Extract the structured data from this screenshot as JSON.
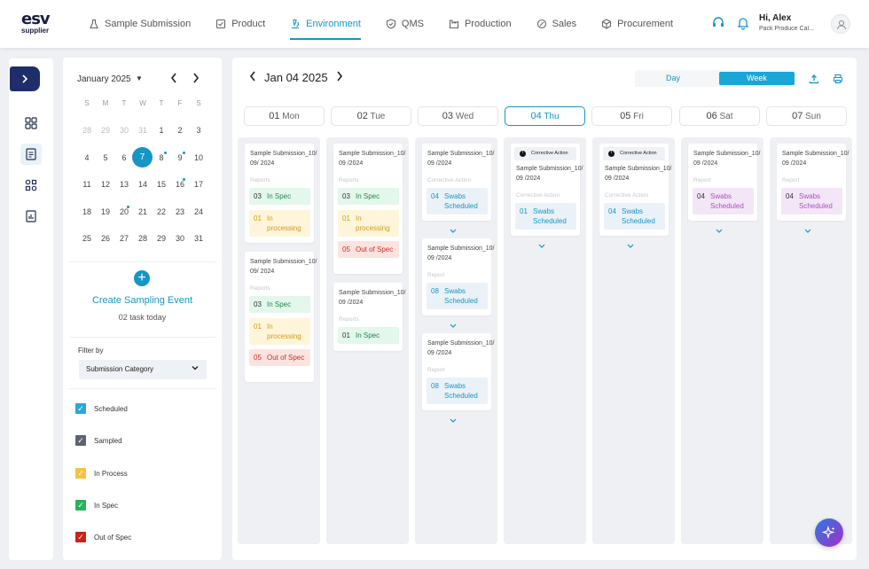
{
  "brand": {
    "logo_main": "esv",
    "logo_sub": "supplier"
  },
  "nav": {
    "items": [
      {
        "label": "Sample Submission",
        "icon": "flask-icon"
      },
      {
        "label": "Product",
        "icon": "box-check-icon"
      },
      {
        "label": "Environment",
        "icon": "microscope-icon",
        "active": true
      },
      {
        "label": "QMS",
        "icon": "shield-check-icon"
      },
      {
        "label": "Production",
        "icon": "factory-icon"
      },
      {
        "label": "Sales",
        "icon": "tag-icon"
      },
      {
        "label": "Procurement",
        "icon": "cube-icon"
      }
    ]
  },
  "user": {
    "greeting": "Hi, Alex",
    "org": "Pack Produce Cal..."
  },
  "calendar": {
    "month": "January 2025",
    "weekdays": [
      "S",
      "M",
      "T",
      "W",
      "T",
      "F",
      "S"
    ],
    "weeks": [
      [
        "28",
        "29",
        "30",
        "31",
        "1",
        "2",
        "3"
      ],
      [
        "4",
        "5",
        "6",
        "7",
        "8",
        "9",
        "10"
      ],
      [
        "11",
        "12",
        "13",
        "14",
        "15",
        "16",
        "17"
      ],
      [
        "18",
        "19",
        "20",
        "21",
        "22",
        "23",
        "24"
      ],
      [
        "25",
        "26",
        "27",
        "28",
        "29",
        "30",
        "31"
      ]
    ],
    "selected": "7"
  },
  "sampling": {
    "create_label": "Create Sampling Event",
    "task_count": "02 task today"
  },
  "filter": {
    "label": "Filter by",
    "selected": "Submission Category",
    "options": [
      {
        "label": "Scheduled",
        "color": "#2aa8d8"
      },
      {
        "label": "Sampled",
        "color": "#5d6470"
      },
      {
        "label": "In Process",
        "color": "#f5c342"
      },
      {
        "label": "In Spec",
        "color": "#27b35a"
      },
      {
        "label": "Out of Spec",
        "color": "#c8231c"
      }
    ]
  },
  "schedule": {
    "date": "Jan 04 2025",
    "view_day": "Day",
    "view_week": "Week",
    "days": [
      {
        "num": "01",
        "name": "Mon"
      },
      {
        "num": "02",
        "name": "Tue"
      },
      {
        "num": "03",
        "name": "Wed"
      },
      {
        "num": "04",
        "name": "Thu",
        "active": true
      },
      {
        "num": "05",
        "name": "Fri"
      },
      {
        "num": "06",
        "name": "Sat"
      },
      {
        "num": "07",
        "name": "Sun"
      }
    ],
    "columns": [
      [
        {
          "title": "Sample Submission_10/09/ 2024",
          "sub": "Reports",
          "badges": [
            {
              "n": "03",
              "t": "In Spec",
              "k": "green"
            },
            {
              "n": "01",
              "t": "In processing",
              "k": "yellow"
            }
          ]
        },
        {
          "title": "Sample Submission_10/09/ 2024",
          "sub": "Reports",
          "badges": [
            {
              "n": "03",
              "t": "In Spec",
              "k": "green"
            },
            {
              "n": "01",
              "t": "In processing",
              "k": "yellow"
            },
            {
              "n": "05",
              "t": "Out of Spec",
              "k": "red"
            }
          ]
        }
      ],
      [
        {
          "title": "Sample Submission_10/09 /2024",
          "sub": "Reports",
          "badges": [
            {
              "n": "03",
              "t": "In Spec",
              "k": "green"
            },
            {
              "n": "01",
              "t": "In processing",
              "k": "yellow"
            },
            {
              "n": "05",
              "t": "Out of Spec",
              "k": "red"
            }
          ]
        },
        {
          "title": "Sample Submission_10/09 /2024",
          "sub": "Reports",
          "badges": [
            {
              "n": "01",
              "t": "In Spec",
              "k": "green"
            }
          ]
        }
      ],
      [
        {
          "title": "Sample Submission_10/09 /2024",
          "sub": "Corrective Action",
          "badges": [
            {
              "n": "04",
              "t": "Swabs Scheduled",
              "k": "blue"
            }
          ],
          "chevron": true
        },
        {
          "title": "Sample Submission_10/09 /2024",
          "sub": "Report",
          "badges": [
            {
              "n": "08",
              "t": "Swabs Scheduled",
              "k": "blue"
            }
          ],
          "chevron": true
        },
        {
          "title": "Sample Submission_10/09 /2024",
          "sub": "Report",
          "badges": [
            {
              "n": "08",
              "t": "Swabs Scheduled",
              "k": "blue"
            }
          ],
          "chevron": true
        }
      ],
      [
        {
          "banner": "Corrective Action",
          "title": "Sample Submission_10/09 /2024",
          "sub": "Corrective Action",
          "badges": [
            {
              "n": "01",
              "t": "Swabs Scheduled",
              "k": "blue"
            }
          ],
          "chevron": true
        }
      ],
      [
        {
          "banner": "Corrective Action",
          "title": "Sample Submission_10/09 /2024",
          "sub": "Corrective Action",
          "badges": [
            {
              "n": "04",
              "t": "Swabs Scheduled",
              "k": "blue"
            }
          ],
          "chevron": true
        }
      ],
      [
        {
          "title": "Sample Submission_10/09 /2024",
          "sub": "Report",
          "badges": [
            {
              "n": "04",
              "t": "Swabs Scheduled",
              "k": "purple"
            }
          ],
          "chevron": true
        }
      ],
      [
        {
          "title": "Sample Submission_10/09 /2024",
          "sub": "Report",
          "badges": [
            {
              "n": "04",
              "t": "Swabs Scheduled",
              "k": "purple"
            }
          ],
          "chevron": true
        }
      ]
    ]
  }
}
